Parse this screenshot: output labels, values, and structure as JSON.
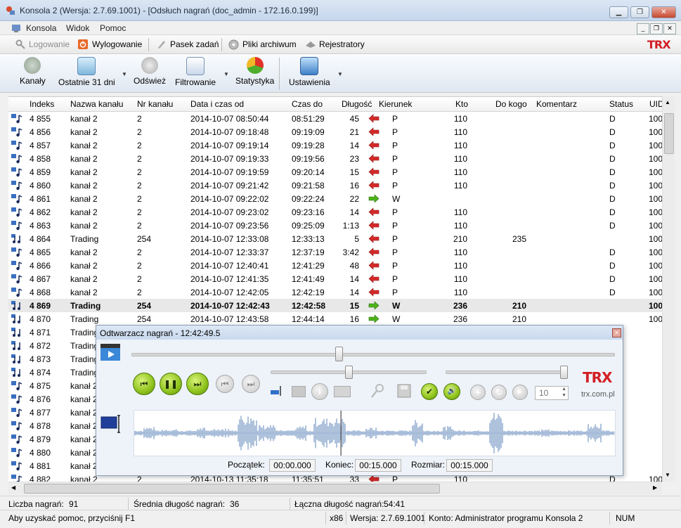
{
  "window": {
    "title": "Konsola 2 (Wersja:  2.7.69.1001) - [Odsłuch nagrań (doc_admin - 172.16.0.199)]"
  },
  "menu": [
    "Konsola",
    "Widok",
    "Pomoc"
  ],
  "toolbar1": {
    "logowanie": "Logowanie",
    "wylogowanie": "Wylogowanie",
    "pasek": "Pasek zadań",
    "pliki": "Pliki archiwum",
    "rejestratory": "Rejestratory"
  },
  "toolbar2": {
    "kanaly": "Kanały",
    "ostatnie": "Ostatnie 31 dni",
    "odswiez": "Odśwież",
    "filtrowanie": "Filtrowanie",
    "statystyka": "Statystyka",
    "ustawienia": "Ustawienia"
  },
  "brand": {
    "logo": "TRX",
    "url": "trx.com.pl"
  },
  "colors": {
    "in_arrow": "#d42a2a",
    "out_arrow": "#4db31a",
    "accent": "#d21f25"
  },
  "table": {
    "headers": [
      "Indeks",
      "Nazwa kanału",
      "Nr kanału",
      "Data i czas od",
      "Czas do",
      "Długość",
      "Kierunek",
      "Kto",
      "Do kogo",
      "Komentarz",
      "Status",
      "UID"
    ],
    "rows": [
      {
        "idx": "4 855",
        "name": "kanał 2",
        "nr": "2",
        "od": "2014-10-07 08:50:44",
        "do": "08:51:29",
        "len": "45",
        "dir": "P",
        "kto": "110",
        "dokogo": "",
        "status": "D",
        "uid": "100"
      },
      {
        "idx": "4 856",
        "name": "kanał 2",
        "nr": "2",
        "od": "2014-10-07 09:18:48",
        "do": "09:19:09",
        "len": "21",
        "dir": "P",
        "kto": "110",
        "dokogo": "",
        "status": "D",
        "uid": "100"
      },
      {
        "idx": "4 857",
        "name": "kanał 2",
        "nr": "2",
        "od": "2014-10-07 09:19:14",
        "do": "09:19:28",
        "len": "14",
        "dir": "P",
        "kto": "110",
        "dokogo": "",
        "status": "D",
        "uid": "100"
      },
      {
        "idx": "4 858",
        "name": "kanał 2",
        "nr": "2",
        "od": "2014-10-07 09:19:33",
        "do": "09:19:56",
        "len": "23",
        "dir": "P",
        "kto": "110",
        "dokogo": "",
        "status": "D",
        "uid": "100"
      },
      {
        "idx": "4 859",
        "name": "kanał 2",
        "nr": "2",
        "od": "2014-10-07 09:19:59",
        "do": "09:20:14",
        "len": "15",
        "dir": "P",
        "kto": "110",
        "dokogo": "",
        "status": "D",
        "uid": "100"
      },
      {
        "idx": "4 860",
        "name": "kanał 2",
        "nr": "2",
        "od": "2014-10-07 09:21:42",
        "do": "09:21:58",
        "len": "16",
        "dir": "P",
        "kto": "110",
        "dokogo": "",
        "status": "D",
        "uid": "100"
      },
      {
        "idx": "4 861",
        "name": "kanał 2",
        "nr": "2",
        "od": "2014-10-07 09:22:02",
        "do": "09:22:24",
        "len": "22",
        "dir": "W",
        "kto": "",
        "dokogo": "",
        "status": "D",
        "uid": "100"
      },
      {
        "idx": "4 862",
        "name": "kanał 2",
        "nr": "2",
        "od": "2014-10-07 09:23:02",
        "do": "09:23:16",
        "len": "14",
        "dir": "P",
        "kto": "110",
        "dokogo": "",
        "status": "D",
        "uid": "100"
      },
      {
        "idx": "4 863",
        "name": "kanał 2",
        "nr": "2",
        "od": "2014-10-07 09:23:56",
        "do": "09:25:09",
        "len": "1:13",
        "dir": "P",
        "kto": "110",
        "dokogo": "",
        "status": "D",
        "uid": "100"
      },
      {
        "idx": "4 864",
        "name": "Trading",
        "nr": "254",
        "od": "2014-10-07 12:33:08",
        "do": "12:33:13",
        "len": "5",
        "dir": "P",
        "kto": "210",
        "dokogo": "235",
        "status": "",
        "uid": "100"
      },
      {
        "idx": "4 865",
        "name": "kanał 2",
        "nr": "2",
        "od": "2014-10-07 12:33:37",
        "do": "12:37:19",
        "len": "3:42",
        "dir": "P",
        "kto": "110",
        "dokogo": "",
        "status": "D",
        "uid": "100"
      },
      {
        "idx": "4 866",
        "name": "kanał 2",
        "nr": "2",
        "od": "2014-10-07 12:40:41",
        "do": "12:41:29",
        "len": "48",
        "dir": "P",
        "kto": "110",
        "dokogo": "",
        "status": "D",
        "uid": "100"
      },
      {
        "idx": "4 867",
        "name": "kanał 2",
        "nr": "2",
        "od": "2014-10-07 12:41:35",
        "do": "12:41:49",
        "len": "14",
        "dir": "P",
        "kto": "110",
        "dokogo": "",
        "status": "D",
        "uid": "100"
      },
      {
        "idx": "4 868",
        "name": "kanał 2",
        "nr": "2",
        "od": "2014-10-07 12:42:05",
        "do": "12:42:19",
        "len": "14",
        "dir": "P",
        "kto": "110",
        "dokogo": "",
        "status": "D",
        "uid": "100"
      },
      {
        "idx": "4 869",
        "name": "Trading",
        "nr": "254",
        "od": "2014-10-07 12:42:43",
        "do": "12:42:58",
        "len": "15",
        "dir": "W",
        "kto": "236",
        "dokogo": "210",
        "status": "",
        "uid": "100",
        "selected": true
      },
      {
        "idx": "4 870",
        "name": "Trading",
        "nr": "254",
        "od": "2014-10-07 12:43:58",
        "do": "12:44:14",
        "len": "16",
        "dir": "W",
        "kto": "236",
        "dokogo": "210",
        "status": "",
        "uid": "100"
      },
      {
        "idx": "4 871",
        "name": "Trading",
        "nr": "",
        "od": "",
        "do": "",
        "len": "",
        "dir": "",
        "kto": "",
        "dokogo": "",
        "status": "",
        "uid": ""
      },
      {
        "idx": "4 872",
        "name": "Trading",
        "nr": "",
        "od": "",
        "do": "",
        "len": "",
        "dir": "",
        "kto": "",
        "dokogo": "",
        "status": "",
        "uid": ""
      },
      {
        "idx": "4 873",
        "name": "Trading",
        "nr": "",
        "od": "",
        "do": "",
        "len": "",
        "dir": "",
        "kto": "",
        "dokogo": "",
        "status": "",
        "uid": ""
      },
      {
        "idx": "4 874",
        "name": "Trading",
        "nr": "",
        "od": "",
        "do": "",
        "len": "",
        "dir": "",
        "kto": "",
        "dokogo": "",
        "status": "",
        "uid": ""
      },
      {
        "idx": "4 875",
        "name": "kanał 2",
        "nr": "",
        "od": "",
        "do": "",
        "len": "",
        "dir": "",
        "kto": "",
        "dokogo": "",
        "status": "",
        "uid": ""
      },
      {
        "idx": "4 876",
        "name": "kanał 2",
        "nr": "",
        "od": "",
        "do": "",
        "len": "",
        "dir": "",
        "kto": "",
        "dokogo": "",
        "status": "",
        "uid": ""
      },
      {
        "idx": "4 877",
        "name": "kanał 2",
        "nr": "",
        "od": "",
        "do": "",
        "len": "",
        "dir": "",
        "kto": "",
        "dokogo": "",
        "status": "",
        "uid": ""
      },
      {
        "idx": "4 878",
        "name": "kanał 2",
        "nr": "",
        "od": "",
        "do": "",
        "len": "",
        "dir": "",
        "kto": "",
        "dokogo": "",
        "status": "",
        "uid": ""
      },
      {
        "idx": "4 879",
        "name": "kanał 2",
        "nr": "",
        "od": "",
        "do": "",
        "len": "",
        "dir": "",
        "kto": "",
        "dokogo": "",
        "status": "",
        "uid": ""
      },
      {
        "idx": "4 880",
        "name": "kanał 2",
        "nr": "",
        "od": "",
        "do": "",
        "len": "",
        "dir": "",
        "kto": "",
        "dokogo": "",
        "status": "",
        "uid": ""
      },
      {
        "idx": "4 881",
        "name": "kanał 2",
        "nr": "",
        "od": "",
        "do": "",
        "len": "",
        "dir": "",
        "kto": "",
        "dokogo": "",
        "status": "",
        "uid": ""
      },
      {
        "idx": "4 882",
        "name": "kanał 2",
        "nr": "2",
        "od": "2014-10-13 11:35:18",
        "do": "11:35:51",
        "len": "33",
        "dir": "P",
        "kto": "110",
        "dokogo": "",
        "status": "D",
        "uid": "100"
      }
    ]
  },
  "player": {
    "title": "Odtwarzacz nagrań - 12:42:49.5",
    "volume_value": "10",
    "poczatek_label": "Początek:",
    "poczatek": "00:00.000",
    "koniec_label": "Koniec:",
    "koniec": "00:15.000",
    "rozmiar_label": "Rozmiar:",
    "rozmiar": "00:15.000",
    "position_fraction": 0.43
  },
  "status1": {
    "liczba_label": "Liczba nagrań:",
    "liczba": "91",
    "srednia_label": "Średnia długość nagrań:",
    "srednia": "36",
    "laczna_label": "Łączna długość nagrań:",
    "laczna": "54:41"
  },
  "status2": {
    "help": "Aby uzyskać pomoc, przyciśnij F1",
    "arch": "x86",
    "version": "Wersja: 2.7.69.1001",
    "account": "Konto: Administrator programu Konsola 2",
    "num": "NUM"
  }
}
